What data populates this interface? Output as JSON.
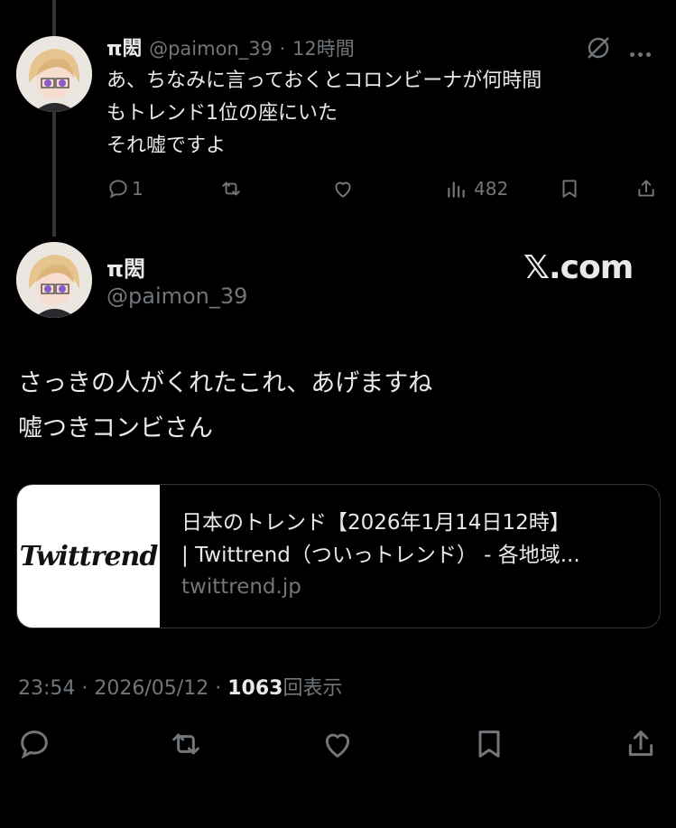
{
  "reply_tweet": {
    "display_name": "π閎",
    "handle": "@paimon_39",
    "separator": "·",
    "time_ago": "12時間",
    "text_lines": [
      "あ、ちなみに言っておくとコロンビーナが何時間",
      "もトレンド1位の座にいた",
      "それ嘘ですよ"
    ],
    "replies": "1",
    "views": "482"
  },
  "main_tweet": {
    "display_name": "π閎",
    "handle": "@paimon_39",
    "watermark": "𝕏.com",
    "text_lines": [
      "さっきの人がくれたこれ、あげますね",
      "嘘つきコンビさん"
    ],
    "link_card": {
      "thumb_text": "Twittrend",
      "title_line1": "日本のトレンド【2026年1月14日12時】",
      "title_line2": "| Twittrend（ついっトレンド） - 各地域...",
      "domain": "twittrend.jp"
    },
    "time": "23:54",
    "date": "2026/05/12",
    "separator": "·",
    "view_count": "1063",
    "view_label": "回表示"
  },
  "colors": {
    "background": "#000000",
    "text": "#e7e9ea",
    "muted": "#71767b",
    "border": "#333639"
  }
}
